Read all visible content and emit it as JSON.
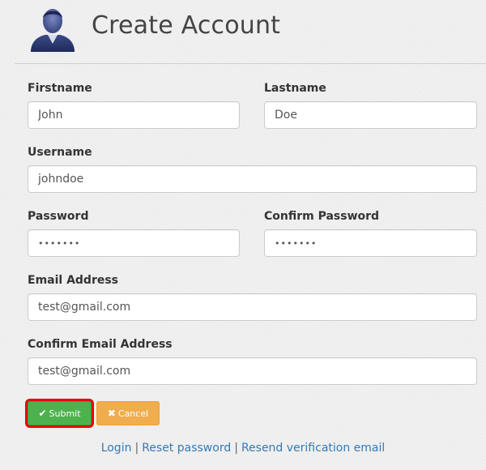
{
  "header": {
    "title": "Create Account",
    "avatar_icon": "user-avatar-icon"
  },
  "form": {
    "firstname": {
      "label": "Firstname",
      "value": "John"
    },
    "lastname": {
      "label": "Lastname",
      "value": "Doe"
    },
    "username": {
      "label": "Username",
      "value": "johndoe"
    },
    "password": {
      "label": "Password",
      "value": "•••••••"
    },
    "confirm_password": {
      "label": "Confirm Password",
      "value": "•••••••"
    },
    "email": {
      "label": "Email Address",
      "value": "test@gmail.com"
    },
    "confirm_email": {
      "label": "Confirm Email Address",
      "value": "test@gmail.com"
    }
  },
  "buttons": {
    "submit": {
      "label": "Submit",
      "icon": "check-icon",
      "glyph": "✔",
      "color": "#4db14d",
      "highlight": "#e8000b"
    },
    "cancel": {
      "label": "Cancel",
      "icon": "close-icon",
      "glyph": "✖",
      "color": "#f0ad4e"
    }
  },
  "links": {
    "login": "Login",
    "reset_password": "Reset password",
    "resend_verification": "Resend verification email",
    "separator": "|"
  }
}
